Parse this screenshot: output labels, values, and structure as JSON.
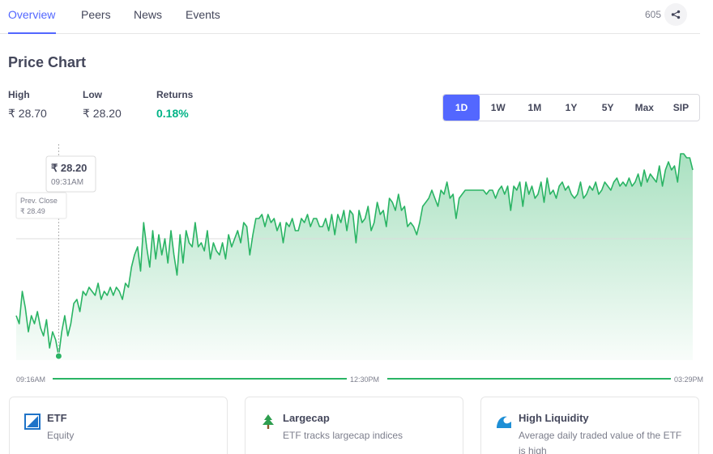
{
  "tabs": [
    {
      "label": "Overview",
      "active": true
    },
    {
      "label": "Peers",
      "active": false
    },
    {
      "label": "News",
      "active": false
    },
    {
      "label": "Events",
      "active": false
    }
  ],
  "share_count": "605",
  "page_title": "Price Chart",
  "stats": {
    "high_label": "High",
    "high_value": "₹ 28.70",
    "low_label": "Low",
    "low_value": "₹ 28.20",
    "returns_label": "Returns",
    "returns_value": "0.18%"
  },
  "ranges": [
    "1D",
    "1W",
    "1M",
    "1Y",
    "5Y",
    "Max",
    "SIP"
  ],
  "active_range": "1D",
  "tooltip": {
    "price": "₹ 28.20",
    "time": "09:31AM"
  },
  "prev_close": {
    "label": "Prev. Close",
    "value": "₹ 28.49"
  },
  "colors": {
    "accent": "#5367ff",
    "positive": "#00b386",
    "line": "#2ab464"
  },
  "chart_data": {
    "type": "area",
    "x_labels": [
      "09:16AM",
      "12:30PM",
      "03:29PM"
    ],
    "series": [
      {
        "values": [
          28.3,
          28.28,
          28.36,
          28.32,
          28.26,
          28.3,
          28.28,
          28.31,
          28.27,
          28.25,
          28.29,
          28.22,
          28.26,
          28.24,
          28.2,
          28.26,
          28.3,
          28.25,
          28.28,
          28.33,
          28.34,
          28.31,
          28.36,
          28.35,
          28.37,
          28.36,
          28.35,
          28.38,
          28.34,
          28.36,
          28.35,
          28.37,
          28.35,
          28.37,
          28.36,
          28.34,
          28.38,
          28.37,
          28.42,
          28.45,
          28.47,
          28.41,
          28.53,
          28.47,
          28.42,
          28.51,
          28.44,
          28.5,
          28.45,
          28.49,
          28.43,
          28.51,
          28.45,
          28.4,
          28.5,
          28.43,
          28.51,
          28.48,
          28.47,
          28.53,
          28.47,
          28.48,
          28.46,
          28.51,
          28.44,
          28.48,
          28.46,
          28.45,
          28.48,
          28.44,
          28.5,
          28.47,
          28.49,
          28.51,
          28.48,
          28.53,
          28.52,
          28.45,
          28.5,
          28.54,
          28.54,
          28.55,
          28.52,
          28.55,
          28.53,
          28.54,
          28.51,
          28.53,
          28.48,
          28.53,
          28.52,
          28.54,
          28.51,
          28.51,
          28.54,
          28.53,
          28.55,
          28.52,
          28.54,
          28.54,
          28.52,
          28.52,
          28.54,
          28.51,
          28.55,
          28.5,
          28.55,
          28.53,
          28.56,
          28.51,
          28.56,
          28.55,
          28.48,
          28.56,
          28.53,
          28.54,
          28.57,
          28.51,
          28.53,
          28.58,
          28.55,
          28.56,
          28.52,
          28.59,
          28.58,
          28.56,
          28.6,
          28.56,
          28.57,
          28.52,
          28.53,
          28.52,
          28.5,
          28.53,
          28.57,
          28.58,
          28.59,
          28.61,
          28.59,
          28.57,
          28.61,
          28.6,
          28.63,
          28.59,
          28.6,
          28.54,
          28.59,
          28.6,
          28.61,
          28.61,
          28.61,
          28.61,
          28.61,
          28.61,
          28.61,
          28.6,
          28.61,
          28.61,
          28.59,
          28.61,
          28.62,
          28.6,
          28.62,
          28.56,
          28.62,
          28.61,
          28.63,
          28.57,
          28.63,
          28.6,
          28.62,
          28.59,
          28.6,
          28.63,
          28.58,
          28.64,
          28.6,
          28.61,
          28.59,
          28.62,
          28.63,
          28.61,
          28.62,
          28.6,
          28.59,
          28.6,
          28.63,
          28.59,
          28.6,
          28.62,
          28.61,
          28.63,
          28.6,
          28.61,
          28.63,
          28.62,
          28.61,
          28.63,
          28.64,
          28.62,
          28.63,
          28.62,
          28.64,
          28.62,
          28.63,
          28.65,
          28.62,
          28.66,
          28.63,
          28.65,
          28.64,
          28.63,
          28.67,
          28.62,
          28.66,
          28.68,
          28.66,
          28.67,
          28.63,
          28.7,
          28.7,
          28.69,
          28.69,
          28.66
        ],
        "color": "#2ab464"
      }
    ],
    "prev_close": 28.49,
    "marker_index": 14,
    "ylim": [
      28.18,
      28.72
    ],
    "grid": false,
    "legend": "none"
  },
  "cards": [
    {
      "icon": "etf-icon",
      "title": "ETF",
      "desc": "Equity"
    },
    {
      "icon": "tree-icon",
      "title": "Largecap",
      "desc": "ETF tracks largecap indices"
    },
    {
      "icon": "wave-icon",
      "title": "High Liquidity",
      "desc": "Average daily traded value of the ETF is high"
    }
  ]
}
